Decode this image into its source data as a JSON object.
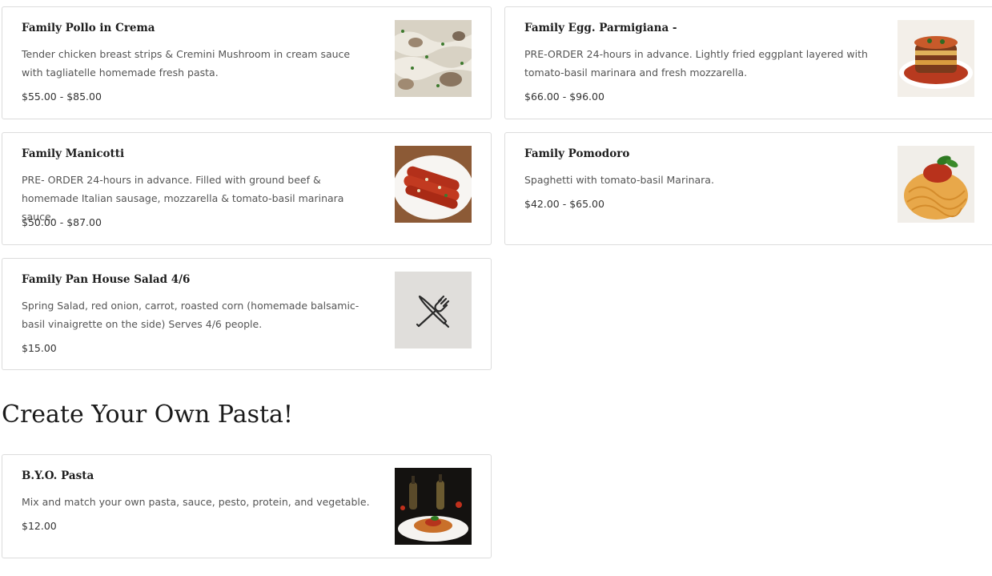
{
  "menu_items": [
    {
      "name": "Family Pollo in Crema",
      "description": "Tender chicken breast strips & Cremini Mushroom in cream sauce with tagliatelle homemade fresh pasta.",
      "price": "$55.00 - $85.00",
      "image": "chicken-mushroom-pasta-photo"
    },
    {
      "name": "Family Egg. Parmigiana -",
      "description": "PRE-ORDER 24-hours in advance. Lightly fried eggplant layered with tomato-basil marinara and fresh mozzarella.",
      "price": "$66.00 - $96.00",
      "image": "eggplant-parmigiana-photo"
    },
    {
      "name": "Family Manicotti",
      "description": "PRE- ORDER 24-hours in advance. Filled with ground beef & homemade Italian sausage, mozzarella & tomato-basil marinara sauce.",
      "price": "$50.00 - $87.00",
      "image": "manicotti-photo"
    },
    {
      "name": "Family Pomodoro",
      "description": "Spaghetti with tomato-basil Marinara.",
      "price": "$42.00 - $65.00",
      "image": "spaghetti-pomodoro-photo"
    },
    {
      "name": "Family Pan House Salad 4/6",
      "description": "Spring Salad, red onion, carrot, roasted corn (homemade balsamic-basil vinaigrette on the side) Serves 4/6 people.",
      "price": "$15.00",
      "image": "fork-knife-placeholder-icon"
    }
  ],
  "section": {
    "title": "Create Your Own Pasta!"
  },
  "byo_item": {
    "name": "B.Y.O. Pasta",
    "description": "Mix and match your own pasta, sauce, pesto, protein, and vegetable.",
    "price": "$12.00",
    "image": "pasta-plate-with-bottles-photo"
  },
  "colors": {
    "card_border": "#dcdcdc",
    "placeholder_bg": "#e0dedb",
    "text_dark": "#1e1e1e",
    "text_muted": "#555555"
  }
}
